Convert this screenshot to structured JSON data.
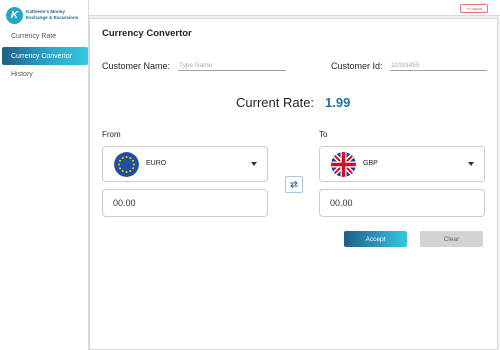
{
  "brand": {
    "mark": "K",
    "line1": "Kathleen's Money",
    "line2": "Exchange & Excursions"
  },
  "sidebar": {
    "items": [
      {
        "label": "Currency Rate"
      },
      {
        "label": "Currency Convertor",
        "active": true
      },
      {
        "label": "History"
      }
    ]
  },
  "topbar": {
    "logout_label": "Logout"
  },
  "main": {
    "title": "Currency Convertor",
    "customer_name_label": "Customer Name:",
    "customer_name_placeholder": "Type Name",
    "customer_id_label": "Customer Id:",
    "customer_id_value": "11033455",
    "rate_label": "Current Rate:",
    "rate_value": "1.99",
    "from": {
      "label": "From",
      "currency": "EURO",
      "flag_icon": "eu-flag-icon",
      "amount": "00.00"
    },
    "to": {
      "label": "To",
      "currency": "GBP",
      "flag_icon": "uk-flag-icon",
      "amount": "00.00"
    },
    "accept_label": "Accept",
    "clear_label": "Clear"
  },
  "colors": {
    "accent": "#1e6fa5",
    "active_gradient_start": "#1f5f86",
    "active_gradient_end": "#33c8df",
    "logout": "#d04b4b",
    "clear_button": "#d3d3d3"
  }
}
